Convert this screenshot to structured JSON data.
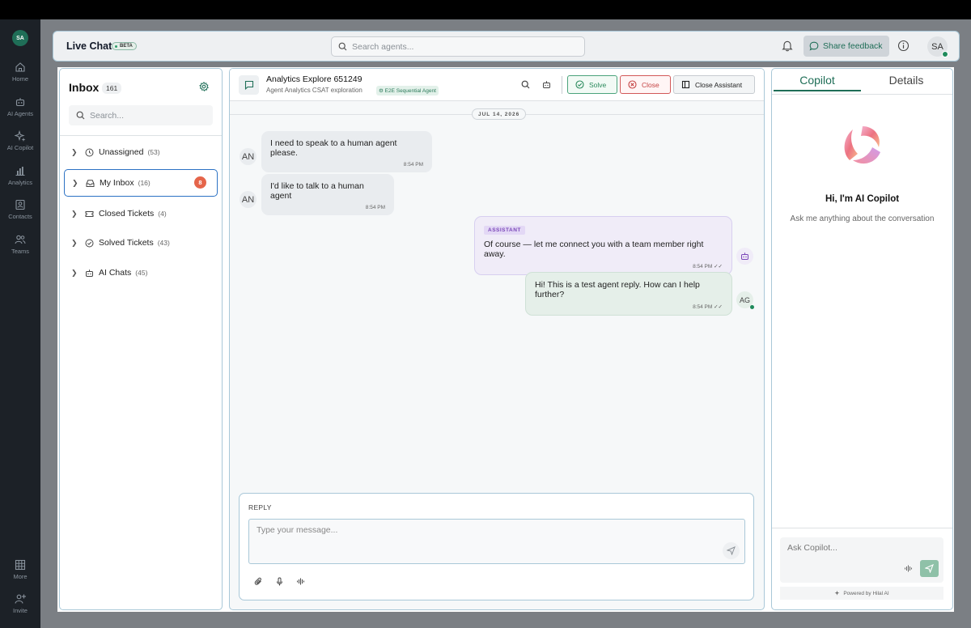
{
  "user_initials": "SA",
  "nav": {
    "items": [
      {
        "label": "Home",
        "icon": "home-icon"
      },
      {
        "label": "AI Agents",
        "icon": "robot-icon"
      },
      {
        "label": "AI Copilot",
        "icon": "sparkle-icon"
      },
      {
        "label": "Analytics",
        "icon": "bar-chart-icon"
      },
      {
        "label": "Contacts",
        "icon": "contact-card-icon"
      },
      {
        "label": "Teams",
        "icon": "users-icon"
      }
    ],
    "bottom": [
      {
        "label": "More",
        "icon": "grid-icon"
      },
      {
        "label": "Invite",
        "icon": "user-plus-icon"
      }
    ]
  },
  "header": {
    "brand": "Live Chat",
    "beta": "BETA",
    "search_placeholder": "Search agents...",
    "share_feedback": "Share feedback",
    "avatar": "SA"
  },
  "inbox": {
    "title": "Inbox",
    "count": "161",
    "search_placeholder": "Search...",
    "folders": [
      {
        "label": "Unassigned",
        "count": "(53)",
        "icon": "clock-icon"
      },
      {
        "label": "My Inbox",
        "count": "(16)",
        "icon": "inbox-icon",
        "badge": "8"
      },
      {
        "label": "Closed Tickets",
        "count": "(4)",
        "icon": "ticket-icon"
      },
      {
        "label": "Solved Tickets",
        "count": "(43)",
        "icon": "check-circle-icon"
      },
      {
        "label": "AI Chats",
        "count": "(45)",
        "icon": "robot-icon"
      }
    ]
  },
  "chat": {
    "title": "Analytics Explore 651249",
    "subtitle": "Agent Analytics CSAT exploration",
    "agent_tag": "E2E Sequential Agent",
    "solve": "Solve",
    "close": "Close",
    "close_assistant": "Close Assistant",
    "date": "JUL 14, 2026",
    "messages": [
      {
        "avatar": "AN",
        "text": "I need to speak to a human agent please.",
        "time": "8:54 PM"
      },
      {
        "avatar": "AN",
        "text": "I'd like to talk to a human agent",
        "time": "8:54 PM"
      },
      {
        "tag": "ASSISTANT",
        "text": "Of course — let me connect you with a team member right away.",
        "time": "8:54 PM"
      },
      {
        "avatar": "AG",
        "text": "Hi! This is a test agent reply. How can I help further?",
        "time": "8:54 PM"
      }
    ],
    "reply_label": "REPLY",
    "reply_placeholder": "Type your message..."
  },
  "copilot": {
    "tab_copilot": "Copilot",
    "tab_details": "Details",
    "greeting": "Hi, I'm AI Copilot",
    "subtitle": "Ask me anything about the conversation",
    "ask_placeholder": "Ask Copilot...",
    "powered_by": "Powered by Hilal AI"
  },
  "colors": {
    "accent": "#1f6e57",
    "active_border": "#2c72c4",
    "badge": "#e5654a",
    "assistant_tag": "#7a46b8"
  }
}
